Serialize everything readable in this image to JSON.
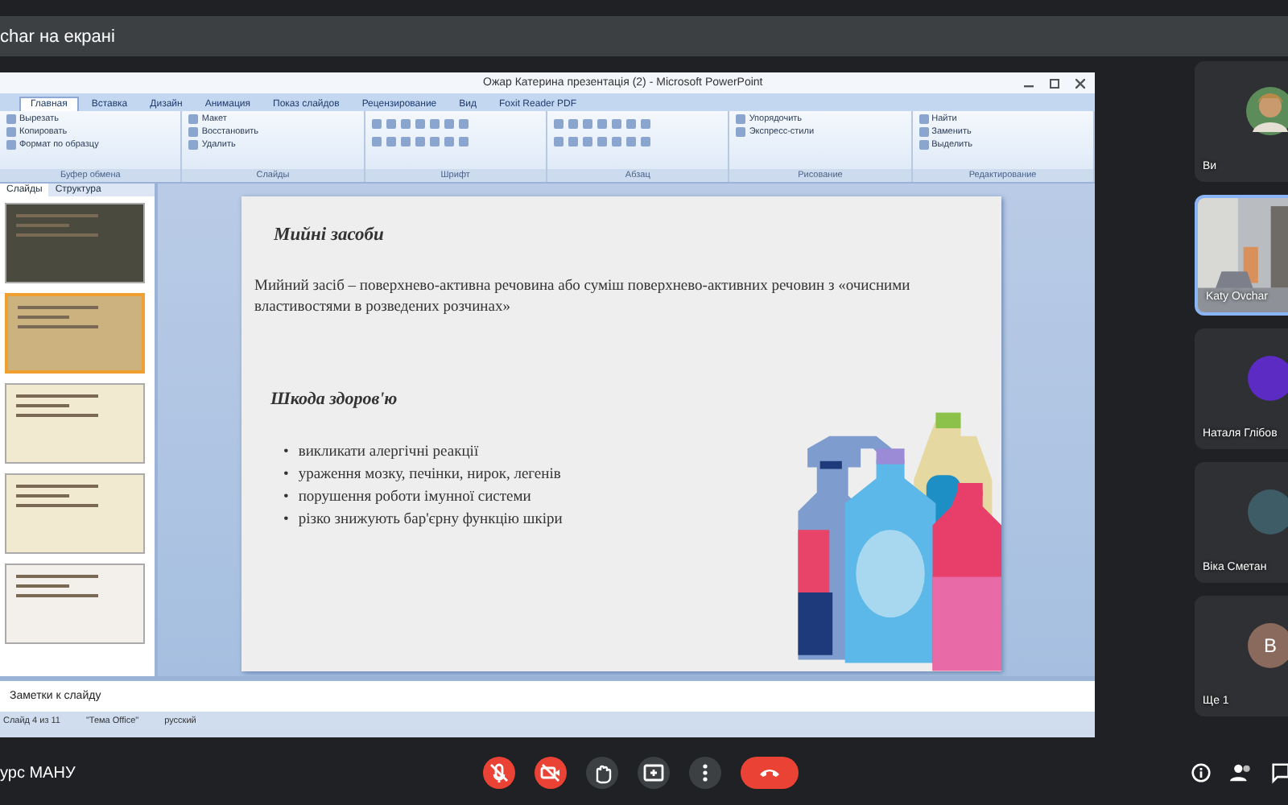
{
  "presenting_bar": {
    "text": "char на екрані"
  },
  "powerpoint": {
    "title": "Ожар Катерина презентація (2) - Microsoft PowerPoint",
    "tabs": [
      {
        "label": "Главная",
        "selected": true
      },
      {
        "label": "Вставка",
        "selected": false
      },
      {
        "label": "Дизайн",
        "selected": false
      },
      {
        "label": "Анимация",
        "selected": false
      },
      {
        "label": "Показ слайдов",
        "selected": false
      },
      {
        "label": "Рецензирование",
        "selected": false
      },
      {
        "label": "Вид",
        "selected": false
      },
      {
        "label": "Foxit Reader PDF",
        "selected": false
      }
    ],
    "ribbon_groups": [
      {
        "label": "Буфер обмена",
        "buttons": [
          "Вырезать",
          "Копировать",
          "Формат по образцу"
        ]
      },
      {
        "label": "Слайды",
        "buttons": [
          "Макет",
          "Восстановить",
          "Удалить"
        ]
      },
      {
        "label": "Шрифт"
      },
      {
        "label": "Абзац"
      },
      {
        "label": "Рисование",
        "buttons": [
          "Упорядочить",
          "Экспресс-стили"
        ]
      },
      {
        "label": "Редактирование",
        "buttons": [
          "Найти",
          "Заменить",
          "Выделить"
        ]
      }
    ],
    "panel_tabs": [
      {
        "label": "Слайды",
        "selected": true
      },
      {
        "label": "Структура",
        "selected": false
      }
    ],
    "thumbnails": [
      {
        "kind": "dark"
      },
      {
        "kind": "tan"
      },
      {
        "kind": "cream"
      },
      {
        "kind": "cream"
      },
      {
        "kind": "light"
      }
    ],
    "slide": {
      "title": "Мийні засоби",
      "definition": "Мийний засіб – поверхнево-активна речовина або суміш поверхнево-активних речовин з «очисними властивостями в розведених розчинах»",
      "subtitle": "Шкода здоров'ю",
      "marker": "•",
      "bullets": [
        "викликати алергічні реакції",
        "ураження мозку, печінки, нирок, легенів",
        "порушення роботи імунної системи",
        "різко знижують бар'єрну функцію шкіри"
      ]
    },
    "notes_placeholder": "Заметки к слайду",
    "status": [
      "Слайд 4 из 11",
      "\"Тема Office\"",
      "русский"
    ]
  },
  "participants": [
    {
      "name": "Ви",
      "speaking": false
    },
    {
      "kind": "video",
      "name": "Katy Ovchar",
      "speaking": true
    },
    {
      "kind": "letter",
      "name": "Наталя Глібов",
      "color": "#5b2bc4",
      "speaking": false
    },
    {
      "kind": "letter",
      "name": "Віка Сметан",
      "color": "#3e5c66",
      "speaking": false
    },
    {
      "kind": "letter",
      "name": "Ще 1",
      "letter": "В",
      "color": "#8a6a5c",
      "speaking": false
    }
  ],
  "meeting_name": "урс МАНУ",
  "controls": [
    {
      "kind": "mic",
      "off": true
    },
    {
      "kind": "camera",
      "off": true
    },
    {
      "kind": "hand",
      "off": false
    },
    {
      "kind": "present",
      "off": false
    },
    {
      "kind": "more",
      "off": false
    },
    {
      "kind": "leave",
      "off": false
    }
  ]
}
